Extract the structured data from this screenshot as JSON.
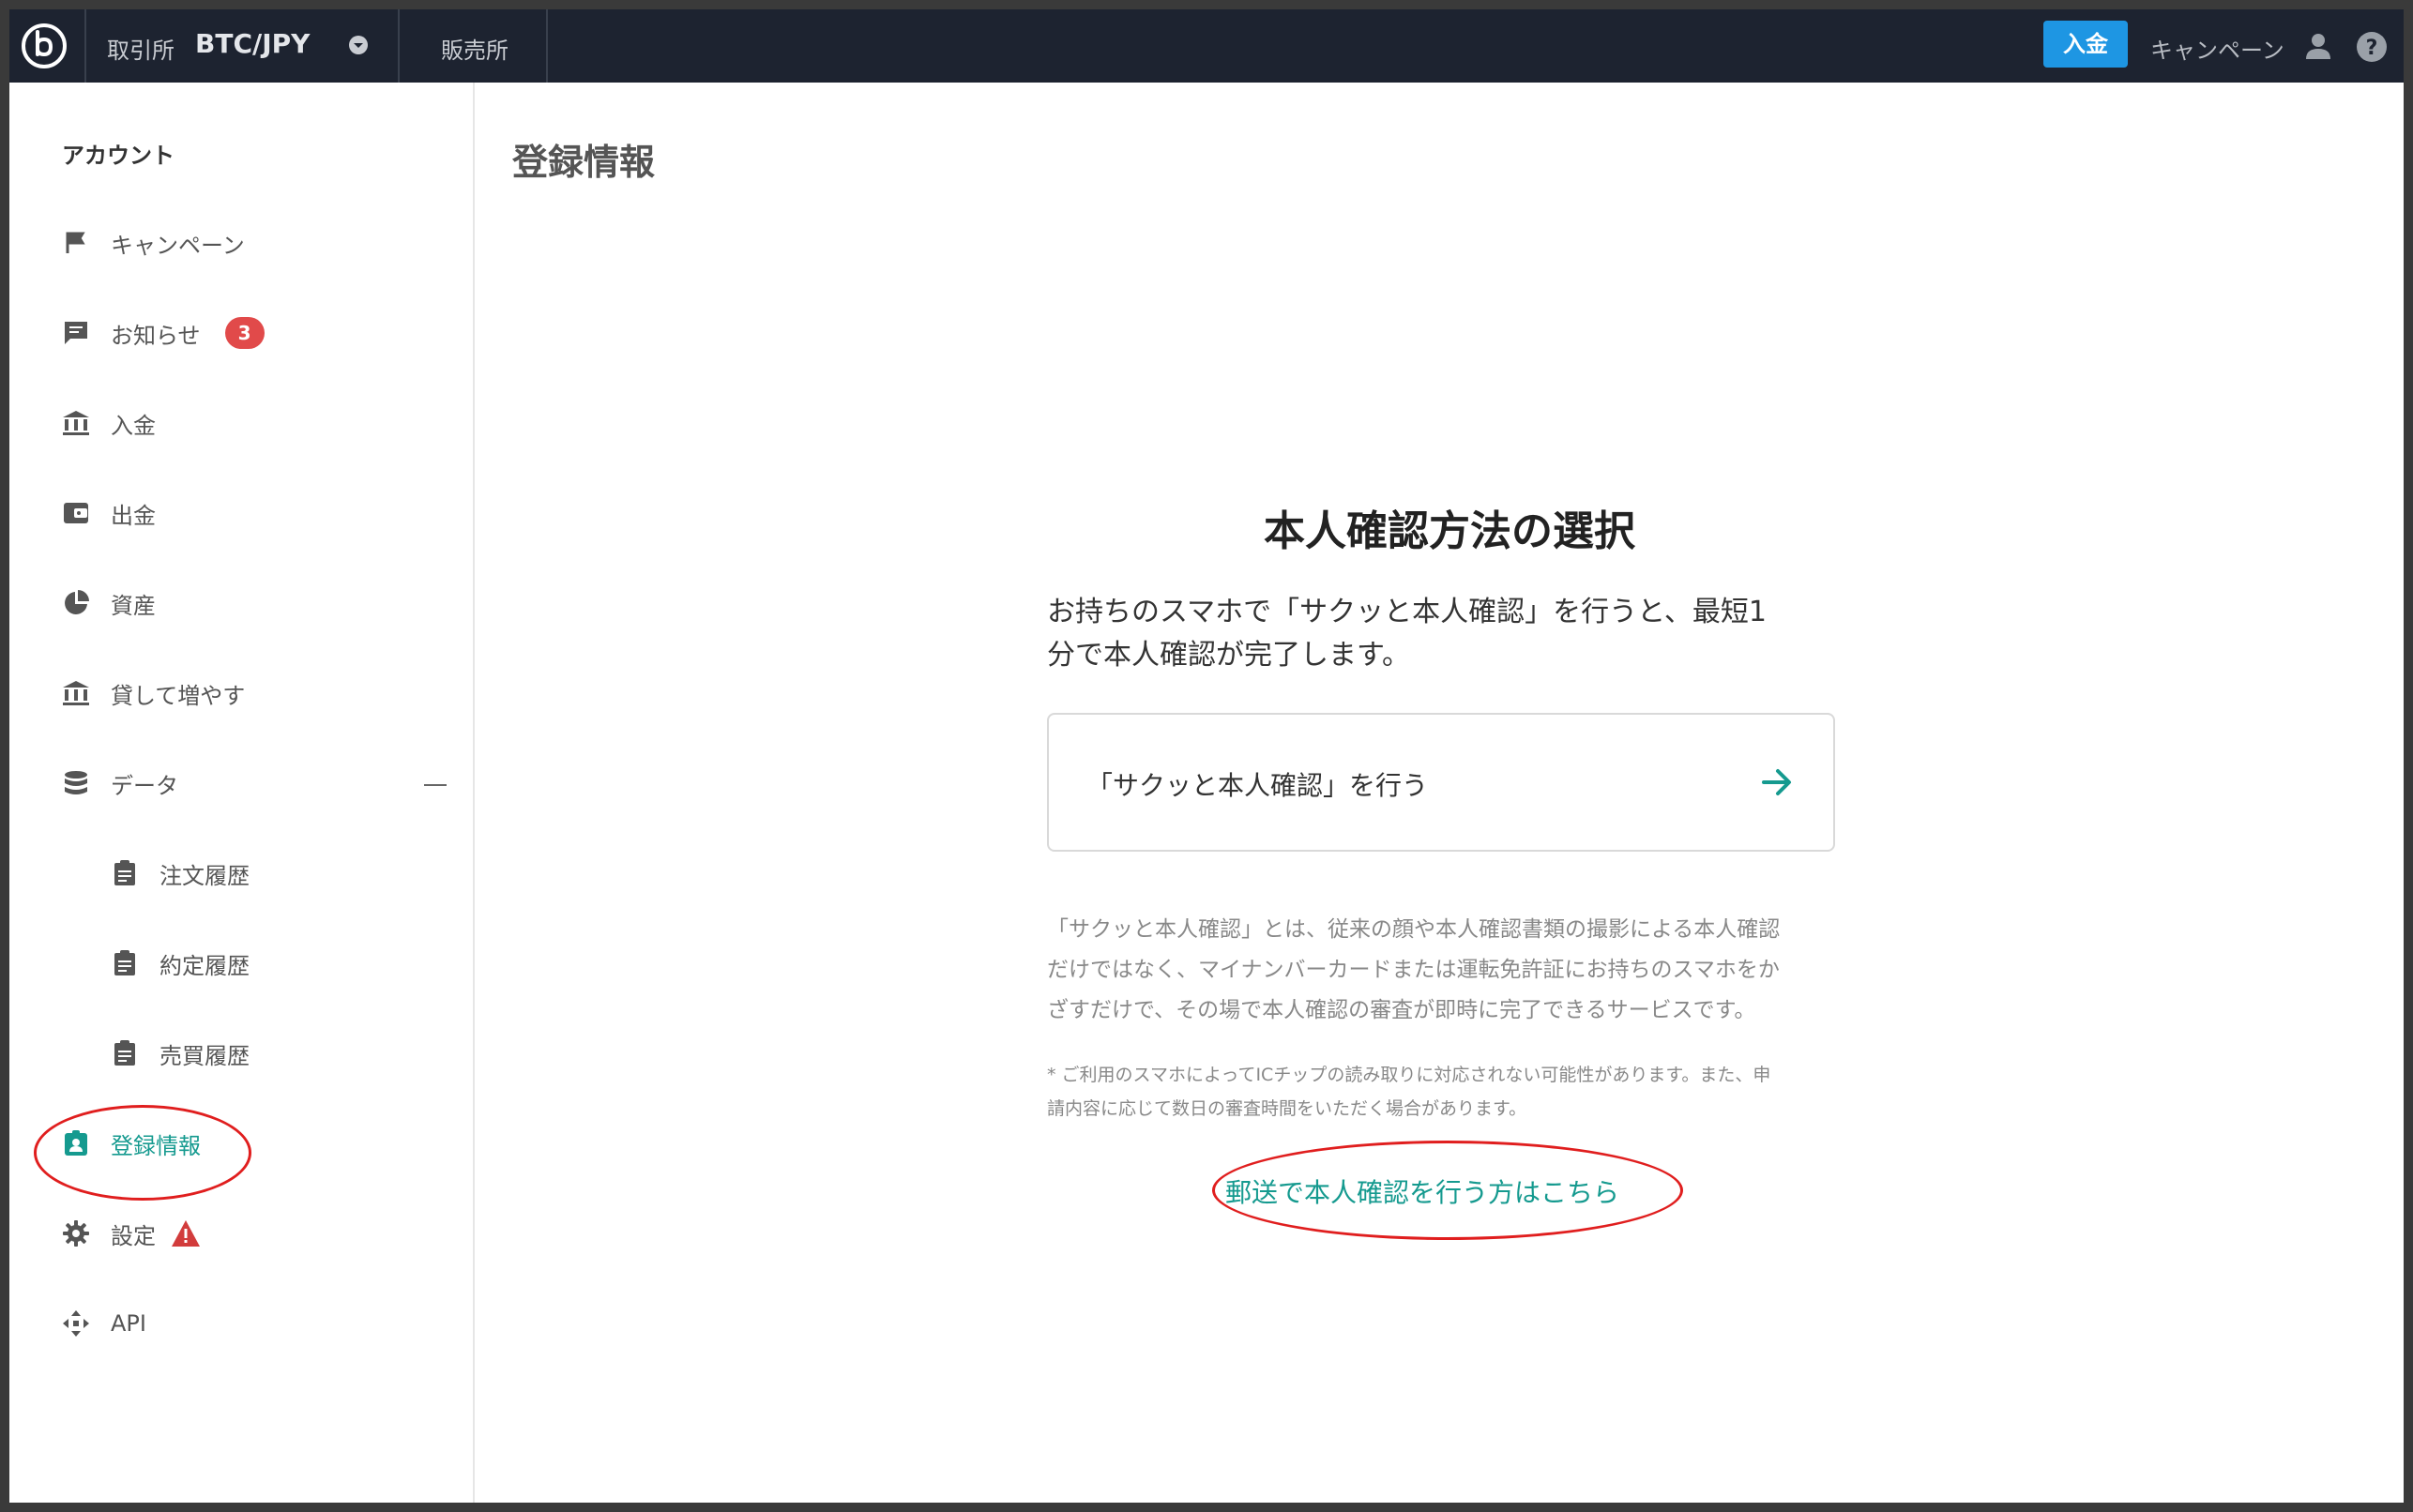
{
  "header": {
    "market_label": "取引所",
    "pair": "BTC/JPY",
    "shop_tab": "販売所",
    "deposit_button": "入金",
    "campaign_link": "キャンペーン"
  },
  "sidebar": {
    "heading": "アカウント",
    "items": [
      {
        "label": "キャンペーン",
        "icon": "flag-icon"
      },
      {
        "label": "お知らせ",
        "icon": "message-icon",
        "badge": "3"
      },
      {
        "label": "入金",
        "icon": "bank-icon"
      },
      {
        "label": "出金",
        "icon": "wallet-icon"
      },
      {
        "label": "資産",
        "icon": "pie-chart-icon"
      },
      {
        "label": "貸して増やす",
        "icon": "bank-icon"
      },
      {
        "label": "データ",
        "icon": "database-icon"
      },
      {
        "label": "注文履歴",
        "icon": "clipboard-icon"
      },
      {
        "label": "約定履歴",
        "icon": "clipboard-icon"
      },
      {
        "label": "売買履歴",
        "icon": "clipboard-icon"
      },
      {
        "label": "登録情報",
        "icon": "id-badge-icon",
        "active": true
      },
      {
        "label": "設定",
        "icon": "gear-icon"
      },
      {
        "label": "API",
        "icon": "api-icon"
      }
    ]
  },
  "main": {
    "page_title": "登録情報",
    "card_title": "本人確認方法の選択",
    "lead_line1": "お持ちのスマホで「サクッと本人確認」を行うと、最短1",
    "lead_line2": "分で本人確認が完了します。",
    "action_label": "「サクッと本人確認」を行う",
    "desc_line1": "「サクッと本人確認」とは、従来の顔や本人確認書類の撮影による本人確認",
    "desc_line2": "だけではなく、マイナンバーカードまたは運転免許証にお持ちのスマホをか",
    "desc_line3": "ざすだけで、その場で本人確認の審査が即時に完了できるサービスです。",
    "note_line1": "* ご利用のスマホによってICチップの読み取りに対応されない可能性があります。また、申",
    "note_line2": "請内容に応じて数日の審査時間をいただく場合があります。",
    "mail_link": "郵送で本人確認を行う方はこちら"
  },
  "colors": {
    "header_bg": "#1d2330",
    "accent": "#159a8f",
    "deposit_blue": "#1e96e3",
    "badge_red": "#e14a4a",
    "annotation_red": "#e01e1e"
  }
}
